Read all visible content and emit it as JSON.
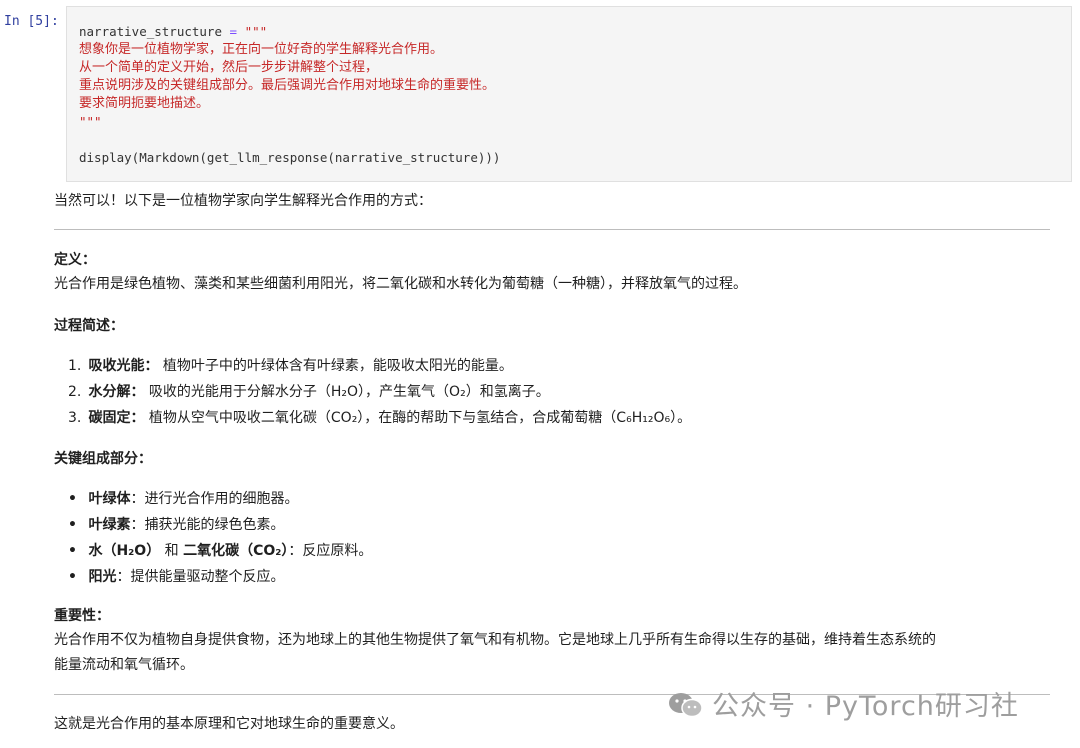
{
  "input_cell": {
    "prompt": "In [5]:",
    "code": {
      "var": "narrative_structure",
      "assign": " = ",
      "open_quote": "\"\"\"",
      "lines": [
        "想象你是一位植物学家，正在向一位好奇的学生解释光合作用。",
        "从一个简单的定义开始，然后一步步讲解整个过程，",
        "重点说明涉及的关键组成部分。最后强调光合作用对地球生命的重要性。",
        "要求简明扼要地描述。"
      ],
      "close_quote": "\"\"\"",
      "call": "display(Markdown(get_llm_response(narrative_structure)))"
    }
  },
  "output": {
    "intro": "当然可以！以下是一位植物学家向学生解释光合作用的方式：",
    "definition": {
      "heading": "定义：",
      "text": "光合作用是绿色植物、藻类和某些细菌利用阳光，将二氧化碳和水转化为葡萄糖（一种糖），并释放氧气的过程。"
    },
    "process": {
      "heading": "过程简述：",
      "items": [
        {
          "num": "1.",
          "bold": "吸收光能：",
          "text": " 植物叶子中的叶绿体含有叶绿素，能吸收太阳光的能量。"
        },
        {
          "num": "2.",
          "bold": "水分解：",
          "text": " 吸收的光能用于分解水分子（H₂O），产生氧气（O₂）和氢离子。"
        },
        {
          "num": "3.",
          "bold": "碳固定：",
          "text": " 植物从空气中吸收二氧化碳（CO₂），在酶的帮助下与氢结合，合成葡萄糖（C₆H₁₂O₆）。"
        }
      ]
    },
    "components": {
      "heading": "关键组成部分：",
      "items": [
        {
          "bold": "叶绿体",
          "text": "：进行光合作用的细胞器。"
        },
        {
          "bold": "叶绿素",
          "text": "：捕获光能的绿色色素。"
        },
        {
          "bold": "水（H₂O）",
          "mid": " 和 ",
          "bold2": "二氧化碳（CO₂）",
          "text": "：反应原料。"
        },
        {
          "bold": "阳光",
          "text": "：提供能量驱动整个反应。"
        }
      ]
    },
    "importance": {
      "heading": "重要性：",
      "line1": "光合作用不仅为植物自身提供食物，还为地球上的其他生物提供了氧气和有机物。它是地球上几乎所有生命得以生存的基础，维持着生态系统的",
      "line2": "能量流动和氧气循环。"
    },
    "conclusion": "这就是光合作用的基本原理和它对地球生命的重要意义。"
  },
  "watermark": {
    "text": "公众号 · PyTorch研习社",
    "icon": "wechat-icon"
  }
}
